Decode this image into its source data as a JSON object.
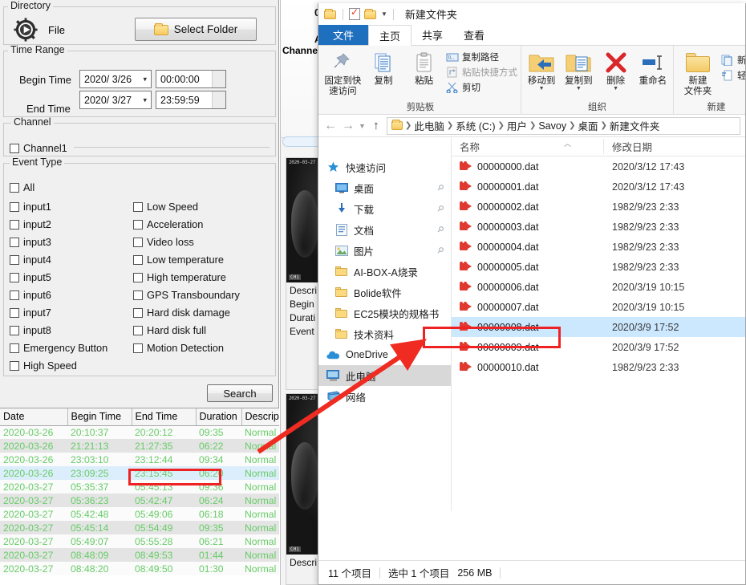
{
  "search_panel": {
    "directory": {
      "group_label": "Directory",
      "file_label": "File",
      "select_folder_button": "Select Folder"
    },
    "time_range": {
      "group_label": "Time Range",
      "begin_label": "Begin Time",
      "begin_date": "2020/ 3/26",
      "begin_time": "00:00:00",
      "end_label": "End Time",
      "end_date": "2020/ 3/27",
      "end_time": "23:59:59"
    },
    "channel": {
      "group_label": "Channel",
      "items": [
        {
          "label": "Channel1",
          "checked": false
        }
      ]
    },
    "event_type": {
      "group_label": "Event Type",
      "all": {
        "label": "All",
        "checked": false
      },
      "left_column": [
        {
          "label": "input1",
          "checked": false
        },
        {
          "label": "input2",
          "checked": false
        },
        {
          "label": "input3",
          "checked": false
        },
        {
          "label": "input4",
          "checked": false
        },
        {
          "label": "input5",
          "checked": false
        },
        {
          "label": "input6",
          "checked": false
        },
        {
          "label": "input7",
          "checked": false
        },
        {
          "label": "input8",
          "checked": false
        },
        {
          "label": "Emergency Button",
          "checked": false
        },
        {
          "label": "High Speed",
          "checked": false
        }
      ],
      "right_column": [
        {
          "label": "Low Speed",
          "checked": false
        },
        {
          "label": "Acceleration",
          "checked": false
        },
        {
          "label": "Video loss",
          "checked": false
        },
        {
          "label": "Low temperature",
          "checked": false
        },
        {
          "label": "High temperature",
          "checked": false
        },
        {
          "label": "GPS Transboundary",
          "checked": false
        },
        {
          "label": "Hard disk damage",
          "checked": false
        },
        {
          "label": "Hard disk full",
          "checked": false
        },
        {
          "label": "Motion Detection",
          "checked": false
        }
      ]
    },
    "search_button": "Search",
    "results": {
      "columns": [
        "Date",
        "Begin Time",
        "End Time",
        "Duration",
        "Descript"
      ],
      "rows": [
        {
          "date": "2020-03-26",
          "begin": "20:10:37",
          "end": "20:20:12",
          "duration": "09:35",
          "desc": "Normal"
        },
        {
          "date": "2020-03-26",
          "begin": "21:21:13",
          "end": "21:27:35",
          "duration": "06:22",
          "desc": "Normal"
        },
        {
          "date": "2020-03-26",
          "begin": "23:03:10",
          "end": "23:12:44",
          "duration": "09:34",
          "desc": "Normal"
        },
        {
          "date": "2020-03-26",
          "begin": "23:09:25",
          "end": "23:15:45",
          "duration": "06:20",
          "desc": "Normal"
        },
        {
          "date": "2020-03-27",
          "begin": "05:35:37",
          "end": "05:45:13",
          "duration": "09:36",
          "desc": "Normal"
        },
        {
          "date": "2020-03-27",
          "begin": "05:36:23",
          "end": "05:42:47",
          "duration": "06:24",
          "desc": "Normal"
        },
        {
          "date": "2020-03-27",
          "begin": "05:42:48",
          "end": "05:49:06",
          "duration": "06:18",
          "desc": "Normal"
        },
        {
          "date": "2020-03-27",
          "begin": "05:45:14",
          "end": "05:54:49",
          "duration": "09:35",
          "desc": "Normal"
        },
        {
          "date": "2020-03-27",
          "begin": "05:49:07",
          "end": "05:55:28",
          "duration": "06:21",
          "desc": "Normal"
        },
        {
          "date": "2020-03-27",
          "begin": "08:48:09",
          "end": "08:49:53",
          "duration": "01:44",
          "desc": "Normal"
        },
        {
          "date": "2020-03-27",
          "begin": "08:48:20",
          "end": "08:49:50",
          "duration": "01:30",
          "desc": "Normal"
        }
      ],
      "selected_row_index": 3
    }
  },
  "playback_panel": {
    "title_fragment": "00",
    "label_a": "A",
    "label_channel": "Channel",
    "thumbnails": [
      {
        "timestamp_overlay": "2020-03-27 23:",
        "corner_overlay": "CH1",
        "meta_lines": [
          "Descri",
          "Begin",
          "Durati",
          "Event "
        ]
      },
      {
        "timestamp_overlay": "2020-03-27 05:",
        "corner_overlay": "CH1",
        "meta_lines": [
          "Descri"
        ]
      }
    ]
  },
  "explorer": {
    "window_title": "新建文件夹",
    "quick_access_icons": [
      "folder-icon",
      "properties-icon",
      "new-folder-icon",
      "chevron-down-icon"
    ],
    "tabs": [
      {
        "label": "文件",
        "kind": "file"
      },
      {
        "label": "主页",
        "kind": "active"
      },
      {
        "label": "共享",
        "kind": "normal"
      },
      {
        "label": "查看",
        "kind": "normal"
      }
    ],
    "ribbon_groups": [
      {
        "label": "剪贴板",
        "big_buttons": [
          {
            "line1": "固定到快",
            "line2": "速访问",
            "icon": "pin-icon"
          },
          {
            "line1": "复制",
            "line2": "",
            "icon": "copy-icon"
          },
          {
            "line1": "粘贴",
            "line2": "",
            "icon": "paste-icon"
          }
        ],
        "small_buttons": [
          {
            "label": "复制路径",
            "icon": "copy-path-icon"
          },
          {
            "label": "粘贴快捷方式",
            "icon": "paste-shortcut-icon"
          },
          {
            "label": "剪切",
            "icon": "scissors-icon"
          }
        ]
      },
      {
        "label": "组织",
        "big_buttons": [
          {
            "line1": "移动到",
            "line2": "",
            "icon": "move-to-icon",
            "has_dropdown": true
          },
          {
            "line1": "复制到",
            "line2": "",
            "icon": "copy-to-icon",
            "has_dropdown": true
          },
          {
            "line1": "删除",
            "line2": "",
            "icon": "delete-icon",
            "has_dropdown": true
          },
          {
            "line1": "重命名",
            "line2": "",
            "icon": "rename-icon"
          }
        ],
        "small_buttons": []
      },
      {
        "label": "新建",
        "big_buttons": [
          {
            "line1": "新建",
            "line2": "文件夹",
            "icon": "new-folder-icon"
          }
        ],
        "small_buttons": [
          {
            "label": "新建",
            "icon": "new-item-icon"
          },
          {
            "label": "轻松",
            "icon": "easy-access-icon"
          }
        ]
      }
    ],
    "breadcrumb": [
      "此电脑",
      "系统 (C:)",
      "用户",
      "Savoy",
      "桌面",
      "新建文件夹"
    ],
    "nav_pane": [
      {
        "label": "快速访问",
        "icon": "star-icon",
        "indent": false,
        "pinned": false,
        "selected": false
      },
      {
        "label": "桌面",
        "icon": "desktop-icon",
        "indent": true,
        "pinned": true,
        "selected": false
      },
      {
        "label": "下载",
        "icon": "download-icon",
        "indent": true,
        "pinned": true,
        "selected": false
      },
      {
        "label": "文档",
        "icon": "documents-icon",
        "indent": true,
        "pinned": true,
        "selected": false
      },
      {
        "label": "图片",
        "icon": "pictures-icon",
        "indent": true,
        "pinned": true,
        "selected": false
      },
      {
        "label": "AI-BOX-A烧录",
        "icon": "folder-icon",
        "indent": true,
        "pinned": false,
        "selected": false
      },
      {
        "label": "Bolide软件",
        "icon": "folder-icon",
        "indent": true,
        "pinned": false,
        "selected": false
      },
      {
        "label": "EC25模块的规格书",
        "icon": "folder-icon",
        "indent": true,
        "pinned": false,
        "selected": false
      },
      {
        "label": "技术资料",
        "icon": "folder-icon",
        "indent": true,
        "pinned": false,
        "selected": false
      },
      {
        "label": "OneDrive",
        "icon": "onedrive-icon",
        "indent": false,
        "pinned": false,
        "selected": false
      },
      {
        "label": "此电脑",
        "icon": "this-pc-icon",
        "indent": false,
        "pinned": false,
        "selected": true
      },
      {
        "label": "网络",
        "icon": "network-icon",
        "indent": false,
        "pinned": false,
        "selected": false
      }
    ],
    "columns": {
      "name": "名称",
      "modified": "修改日期"
    },
    "files": [
      {
        "name": "00000000.dat",
        "modified": "2020/3/12 17:43",
        "selected": false
      },
      {
        "name": "00000001.dat",
        "modified": "2020/3/12 17:43",
        "selected": false
      },
      {
        "name": "00000002.dat",
        "modified": "1982/9/23 2:33",
        "selected": false
      },
      {
        "name": "00000003.dat",
        "modified": "1982/9/23 2:33",
        "selected": false
      },
      {
        "name": "00000004.dat",
        "modified": "1982/9/23 2:33",
        "selected": false
      },
      {
        "name": "00000005.dat",
        "modified": "1982/9/23 2:33",
        "selected": false
      },
      {
        "name": "00000006.dat",
        "modified": "2020/3/19 10:15",
        "selected": false
      },
      {
        "name": "00000007.dat",
        "modified": "2020/3/19 10:15",
        "selected": false
      },
      {
        "name": "00000008.dat",
        "modified": "2020/3/9 17:52",
        "selected": true
      },
      {
        "name": "00000009.dat",
        "modified": "2020/3/9 17:52",
        "selected": false
      },
      {
        "name": "00000010.dat",
        "modified": "1982/9/23 2:33",
        "selected": false
      }
    ],
    "status_bar": {
      "item_count": "11 个项目",
      "selection": "选中 1 个项目",
      "size": "256 MB"
    }
  },
  "annotations": {
    "arrow_color": "#ef2b22",
    "highlight_color": "#ee2222"
  }
}
